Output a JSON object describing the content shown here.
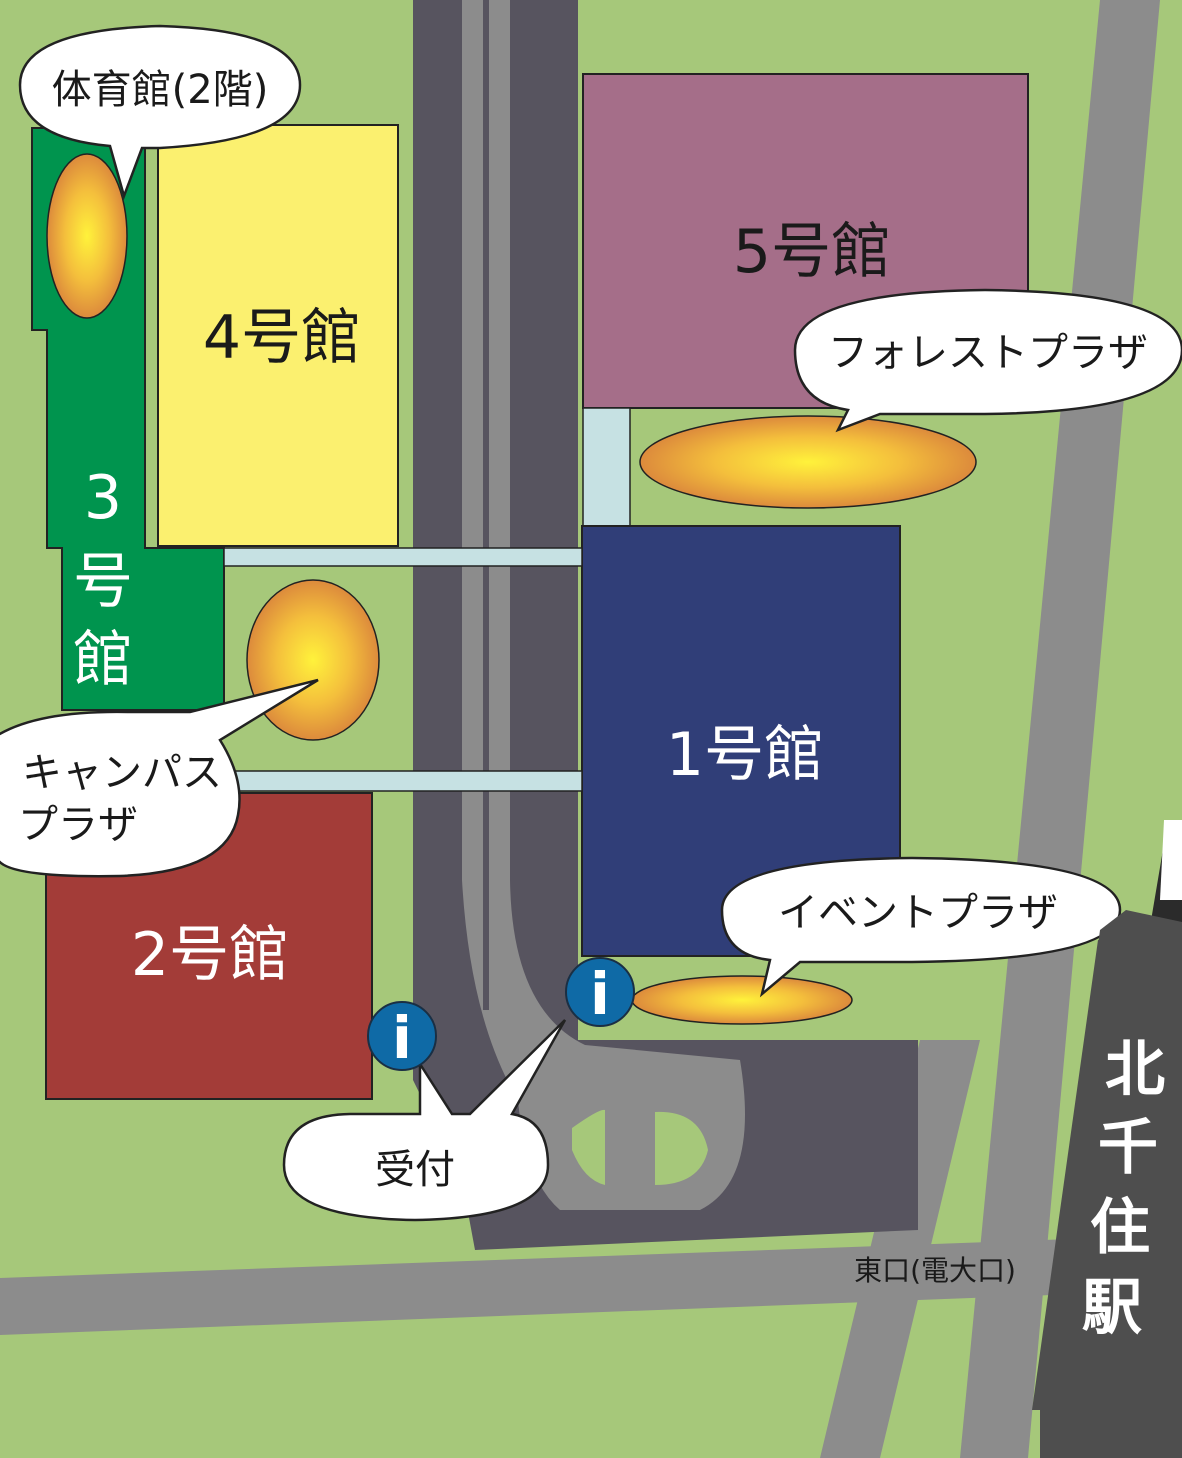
{
  "map": {
    "colors": {
      "grass": "#a6c87a",
      "road_gray": "#8c8c8c",
      "road_dark": "#57545f",
      "building_1": "#303e78",
      "building_2": "#a33c38",
      "building_3": "#00944e",
      "building_4": "#fbf06f",
      "building_5": "#a56e89",
      "walkway": "#c6e1e3",
      "station": "#4e4e4e",
      "info_blue": "#0f6aa6"
    },
    "buildings": {
      "b1": "1号館",
      "b2": "2号館",
      "b3_chars": [
        "3",
        "号",
        "館"
      ],
      "b4": "4号館",
      "b5": "5号館"
    },
    "bubbles": {
      "gym": "体育館(2階)",
      "forest_plaza": "フォレストプラザ",
      "campus_plaza_line1": "キャンパス",
      "campus_plaza_line2": "プラザ",
      "event_plaza": "イベントプラザ",
      "reception": "受付"
    },
    "labels": {
      "east_gate": "東口(電大口)",
      "station_chars": [
        "北",
        "千",
        "住",
        "駅"
      ]
    },
    "icons": {
      "info_a": "info-icon",
      "info_b": "info-icon",
      "info_glyph": "i"
    }
  }
}
